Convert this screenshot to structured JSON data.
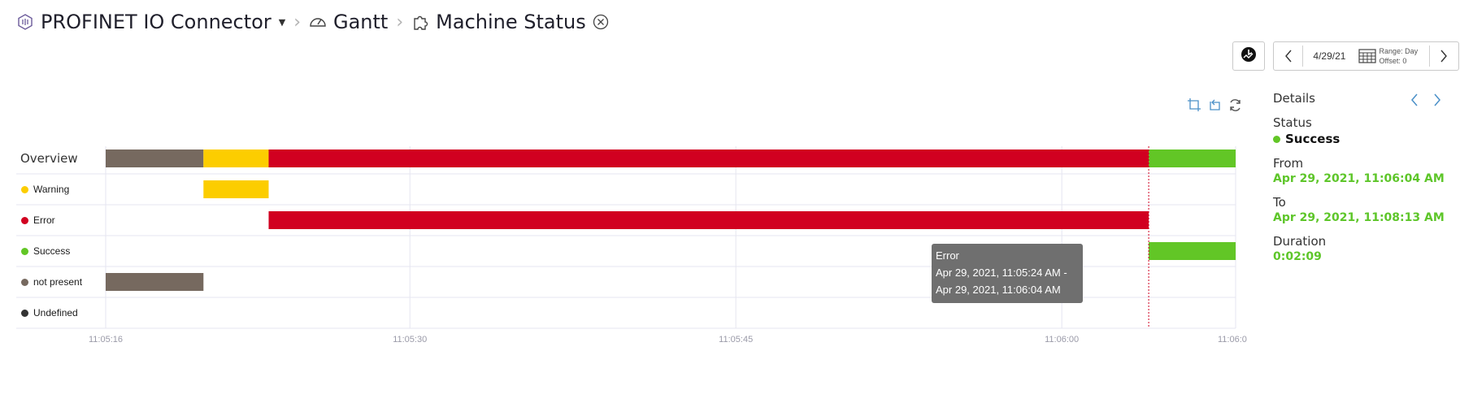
{
  "breadcrumb": {
    "app": "PROFINET IO Connector",
    "section": "Gantt",
    "page": "Machine Status"
  },
  "toolbar": {
    "date": "4/29/21",
    "range": "Range: Day",
    "offset": "Offset: 0"
  },
  "details": {
    "title": "Details",
    "status_label": "Status",
    "status_value": "Success",
    "from_label": "From",
    "from_value": "Apr 29, 2021, 11:06:04 AM",
    "to_label": "To",
    "to_value": "Apr 29, 2021, 11:08:13 AM",
    "duration_label": "Duration",
    "duration_value": "0:02:09"
  },
  "tooltip": {
    "title": "Error",
    "line1": "Apr 29, 2021, 11:05:24 AM -",
    "line2": "Apr 29, 2021, 11:06:04 AM"
  },
  "colors": {
    "warning": "#fccd00",
    "error": "#d10020",
    "success": "#62c626",
    "not_present": "#76695f",
    "undefined": "#333333",
    "axis": "#9a9aa8"
  },
  "chart_data": {
    "type": "gantt",
    "x_axis": {
      "start": "11:05:16",
      "end": "11:06:08",
      "ticks": [
        "11:05:16",
        "11:05:30",
        "11:05:45",
        "11:06:00",
        "11:06:0"
      ]
    },
    "rows": [
      {
        "label": "Overview",
        "color_key": null
      },
      {
        "label": "Warning",
        "color_key": "warning"
      },
      {
        "label": "Error",
        "color_key": "error"
      },
      {
        "label": "Success",
        "color_key": "success"
      },
      {
        "label": "not present",
        "color_key": "not_present"
      },
      {
        "label": "Undefined",
        "color_key": "undefined"
      }
    ],
    "segments": [
      {
        "row": "not present",
        "start": "11:05:16",
        "end": "11:05:20.5",
        "color_key": "not_present"
      },
      {
        "row": "Warning",
        "start": "11:05:20.5",
        "end": "11:05:23.5",
        "color_key": "warning"
      },
      {
        "row": "Error",
        "start": "11:05:23.5",
        "end": "11:06:04",
        "color_key": "error"
      },
      {
        "row": "Success",
        "start": "11:06:04",
        "end": "11:06:08",
        "color_key": "success"
      }
    ],
    "marker": "11:06:04"
  }
}
